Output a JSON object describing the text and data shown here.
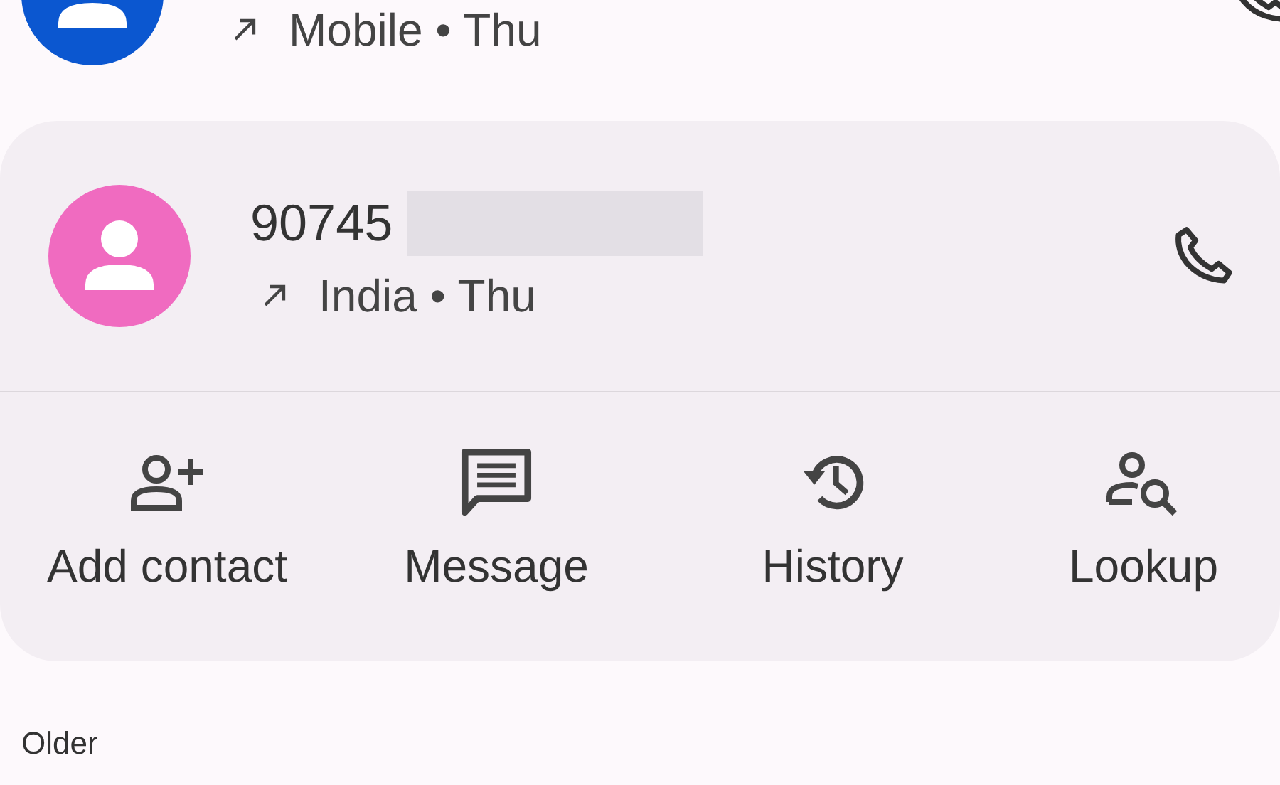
{
  "calls": [
    {
      "kind": "partial",
      "color": "#0b57d0",
      "detail": "Mobile • Thu"
    },
    {
      "kind": "full",
      "color": "#f06bc0",
      "number": "90745",
      "redacted": true,
      "detail": "India • Thu",
      "actions": [
        {
          "kind": "add_contact",
          "label": "Add contact"
        },
        {
          "kind": "message",
          "label": "Message"
        },
        {
          "kind": "history",
          "label": "History"
        },
        {
          "kind": "lookup",
          "label": "Lookup"
        }
      ]
    }
  ],
  "section_header": "Older"
}
